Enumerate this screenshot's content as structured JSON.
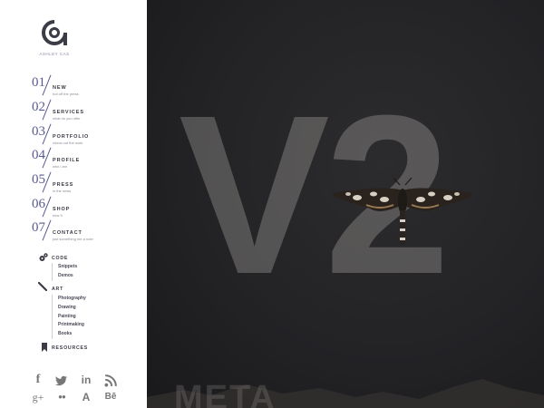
{
  "brand": {
    "name": "ASHLEY CAS",
    "logo_letter": "a"
  },
  "nav": [
    {
      "num": "01",
      "title": "NEW",
      "sub": "hot off the press"
    },
    {
      "num": "02",
      "title": "SERVICES",
      "sub": "what do you offer"
    },
    {
      "num": "03",
      "title": "PORTFOLIO",
      "sub": "check out the work"
    },
    {
      "num": "04",
      "title": "PROFILE",
      "sub": "who i am"
    },
    {
      "num": "05",
      "title": "PRESS",
      "sub": "in the news"
    },
    {
      "num": "06",
      "title": "SHOP",
      "sub": "new 5"
    },
    {
      "num": "07",
      "title": "CONTACT",
      "sub": "just something me a note"
    }
  ],
  "code": {
    "title": "CODE",
    "icon": "gears-icon",
    "items": [
      "Snippets",
      "Demos"
    ]
  },
  "art": {
    "title": "ART",
    "icon": "pencil-icon",
    "items": [
      "Photography",
      "Drawing",
      "Painting",
      "Printmaking",
      "Books"
    ]
  },
  "resources": {
    "title": "RESOURCES",
    "icon": "bookmark-icon"
  },
  "social": {
    "row1": [
      {
        "name": "facebook-icon",
        "glyph": "f"
      },
      {
        "name": "twitter-icon",
        "glyph": ""
      },
      {
        "name": "linkedin-icon",
        "glyph": "in"
      },
      {
        "name": "rss-icon",
        "glyph": ""
      }
    ],
    "row2": [
      {
        "name": "google-plus-icon",
        "glyph": "g+"
      },
      {
        "name": "flickr-icon",
        "glyph": "●●"
      },
      {
        "name": "a-icon",
        "glyph": "A"
      },
      {
        "name": "behance-icon",
        "glyph": "Bē"
      }
    ]
  },
  "hero": {
    "title": "V2",
    "bottom_text": "META"
  },
  "colors": {
    "sidebar_bg": "#ffffff",
    "accent": "#5a5a92",
    "main_bg": "#222225"
  }
}
